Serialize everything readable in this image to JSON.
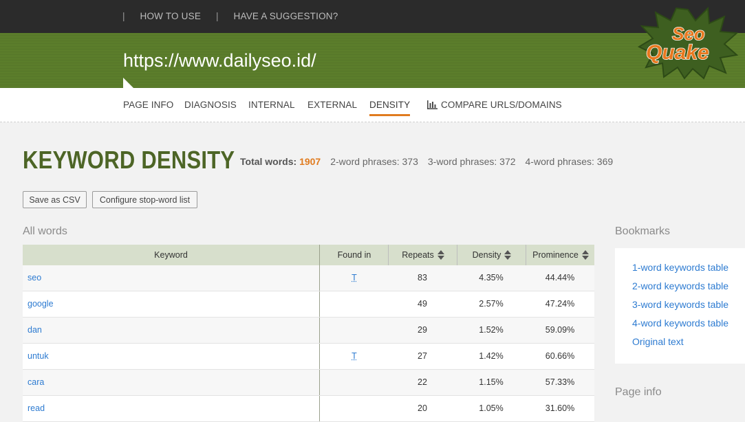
{
  "topnav": {
    "sep": "|",
    "links": [
      "HOW TO USE",
      "HAVE A SUGGESTION?"
    ]
  },
  "banner": {
    "url": "https://www.dailyseo.id/"
  },
  "logo": {
    "line1": "Seo",
    "line2": "Quake"
  },
  "tabs": [
    {
      "label": "PAGE INFO"
    },
    {
      "label": "DIAGNOSIS"
    },
    {
      "label": "INTERNAL"
    },
    {
      "label": "EXTERNAL"
    },
    {
      "label": "DENSITY",
      "active": true
    },
    {
      "label": "COMPARE URLS/DOMAINS",
      "icon": "bar-chart-icon"
    }
  ],
  "page": {
    "title": "KEYWORD DENSITY",
    "total_label": "Total words:",
    "total_value": "1907",
    "phrase2_label": "2-word phrases:",
    "phrase2_value": "373",
    "phrase3_label": "3-word phrases:",
    "phrase3_value": "372",
    "phrase4_label": "4-word phrases:",
    "phrase4_value": "369",
    "save_csv": "Save as CSV",
    "configure": "Configure stop-word list",
    "all_words": "All words",
    "bookmarks_title": "Bookmarks",
    "page_info_title": "Page info"
  },
  "table": {
    "headers": [
      "Keyword",
      "Found in",
      "Repeats",
      "Density",
      "Prominence"
    ],
    "rows": [
      {
        "keyword": "seo",
        "found": "T",
        "repeats": "83",
        "density": "4.35%",
        "prominence": "44.44%"
      },
      {
        "keyword": "google",
        "found": "",
        "repeats": "49",
        "density": "2.57%",
        "prominence": "47.24%"
      },
      {
        "keyword": "dan",
        "found": "",
        "repeats": "29",
        "density": "1.52%",
        "prominence": "59.09%"
      },
      {
        "keyword": "untuk",
        "found": "T",
        "repeats": "27",
        "density": "1.42%",
        "prominence": "60.66%"
      },
      {
        "keyword": "cara",
        "found": "",
        "repeats": "22",
        "density": "1.15%",
        "prominence": "57.33%"
      },
      {
        "keyword": "read",
        "found": "",
        "repeats": "20",
        "density": "1.05%",
        "prominence": "31.60%"
      }
    ]
  },
  "bookmarks": [
    "1-word keywords table",
    "2-word keywords table",
    "3-word keywords table",
    "4-word keywords table",
    "Original text"
  ],
  "colors": {
    "brand_green": "#5b7d2b",
    "title_green": "#4d6526",
    "accent_orange": "#e07b1f",
    "link_blue": "#2d7bd1"
  }
}
